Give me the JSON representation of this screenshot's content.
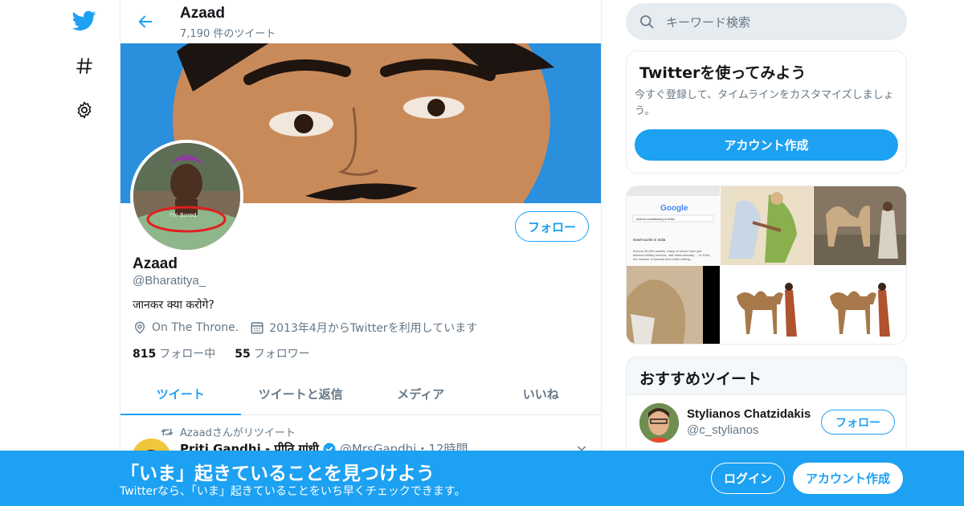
{
  "colors": {
    "accent": "#1da1f2",
    "muted": "#657786",
    "border": "#e6ecf0"
  },
  "nav": {
    "icons": [
      "twitter-bird-icon",
      "hashtag-icon",
      "gear-icon"
    ]
  },
  "header": {
    "name": "Azaad",
    "tweet_count": "7,190 件のツイート"
  },
  "profile": {
    "name": "Azaad",
    "handle": "@Bharatitya_",
    "bio": "जानकर क्या करोगे?",
    "location": "On The Throne.",
    "joined": "2013年4月からTwitterを利用しています",
    "following_count": "815",
    "following_label": "フォロー中",
    "followers_count": "55",
    "followers_label": "フォロワー",
    "follow_button": "フォロー"
  },
  "tabs": [
    {
      "label": "ツイート",
      "active": true
    },
    {
      "label": "ツイートと返信",
      "active": false
    },
    {
      "label": "メディア",
      "active": false
    },
    {
      "label": "いいね",
      "active": false
    }
  ],
  "tweet": {
    "retweet_line": "Azaadさんがリツイート",
    "author": "Priti Gandhi - प्रीति गांधी",
    "handle_time": "@MrsGandhi・12時間"
  },
  "search": {
    "placeholder": "キーワード検索"
  },
  "signup_card": {
    "title": "Twitterを使ってみよう",
    "text": "今すぐ登録して、タイムラインをカスタマイズしましょう。",
    "button": "アカウント作成"
  },
  "media_thumb": {
    "google_logo": "Google",
    "query": "search-vacationing in India",
    "snippet_title": "Israel tourist in India",
    "snippet_text": "Around 40,000 Israelis, many of whom have just finished military service, visit India annually ... In 2016, the number of tourists from India visiting ..."
  },
  "recommended": {
    "title": "おすすめツイート",
    "name": "Stylianos Chatzidakis",
    "handle": "@c_stylianos",
    "follow_button": "フォロー"
  },
  "bottom_bar": {
    "title": "「いま」起きていることを見つけよう",
    "subtitle": "Twitterなら、「いま」起きていることをいち早くチェックできます。",
    "login": "ログイン",
    "signup": "アカウント作成"
  }
}
